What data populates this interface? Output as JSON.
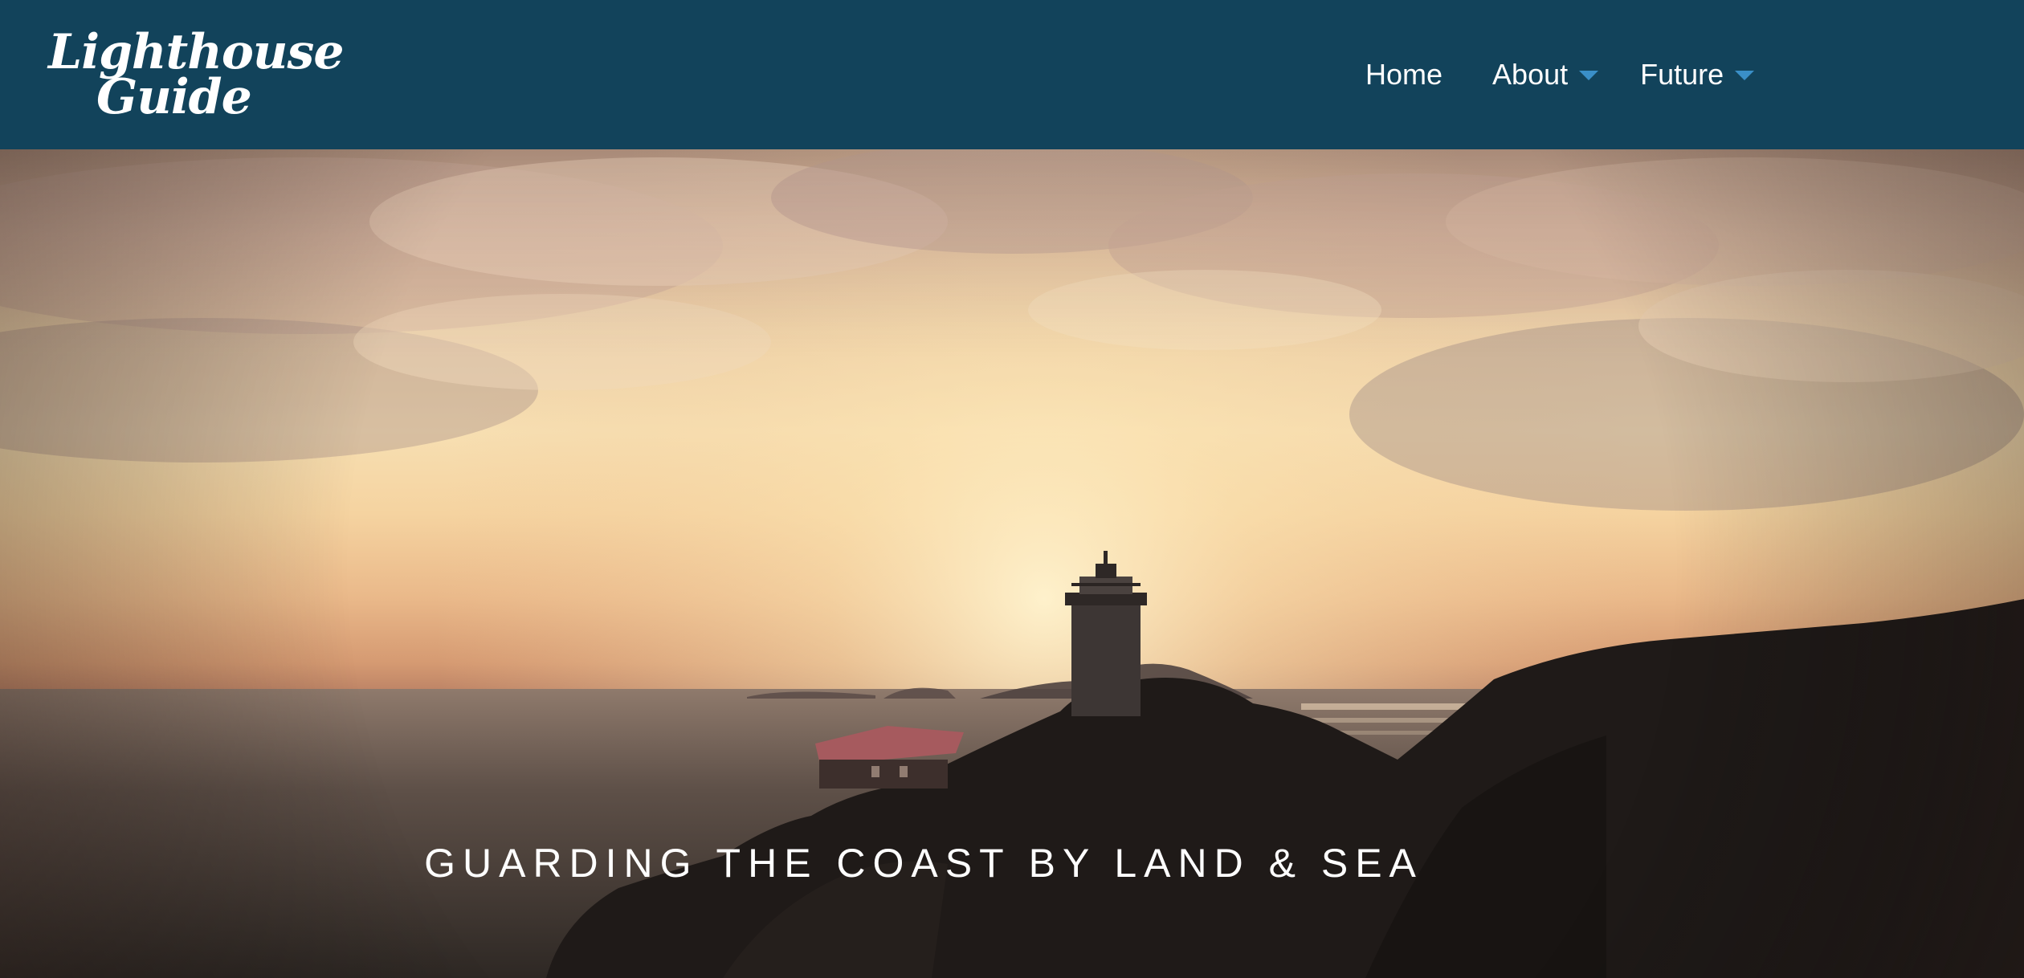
{
  "brand": {
    "logo_line1": "Lighthouse",
    "logo_line2": "Guide",
    "header_color": "#12435b"
  },
  "nav": {
    "items": [
      {
        "label": "Home",
        "has_dropdown": false
      },
      {
        "label": "About",
        "has_dropdown": true
      },
      {
        "label": "Future",
        "has_dropdown": true
      }
    ],
    "caret_color": "#3a8fc8",
    "caret_icon": "caret-down-icon"
  },
  "hero": {
    "tagline": "GUARDING THE COAST BY LAND & SEA",
    "image_subject": "lighthouse-at-sunset"
  }
}
